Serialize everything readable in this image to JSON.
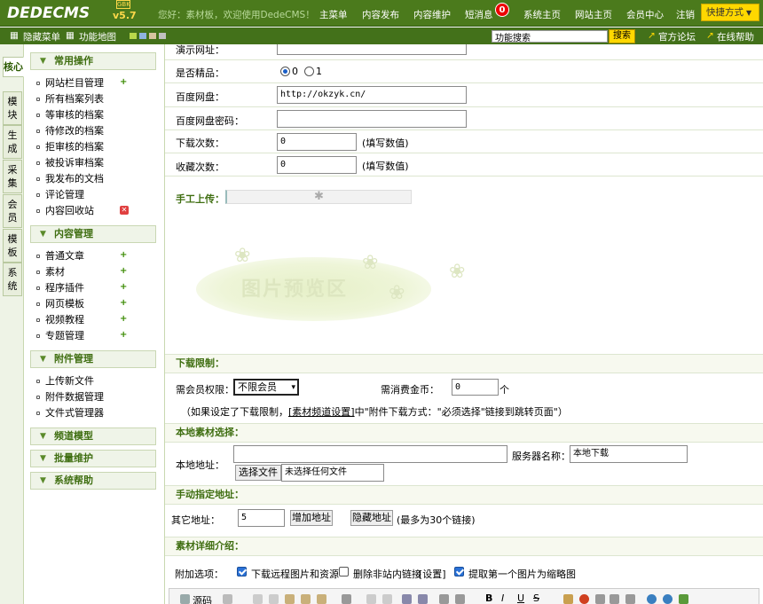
{
  "header": {
    "logo": "DEDECMS",
    "version": "v5.7",
    "badge": "GBK",
    "welcome": "您好：素材板，欢迎使用DedeCMS！",
    "nav": [
      "主菜单",
      "内容发布",
      "内容维护",
      "短消息",
      "系统主页",
      "网站主页",
      "会员中心",
      "注销"
    ],
    "message_count": "0",
    "quick_menu": "快捷方式"
  },
  "subbar": {
    "hide_menu": "隐藏菜单",
    "site_map": "功能地图",
    "search_value": "功能搜索",
    "search_button": "搜索",
    "official_forum": "官方论坛",
    "online_help": "在线帮助"
  },
  "sidebar": {
    "tabs": [
      "核心",
      "模块",
      "生成",
      "采集",
      "会员",
      "模板",
      "系统"
    ],
    "groups": [
      {
        "title": "常用操作",
        "items": [
          "网站栏目管理",
          "所有档案列表",
          "等审核的档案",
          "待修改的档案",
          "拒审核的档案",
          "被投诉审档案",
          "我发布的文档",
          "评论管理",
          "内容回收站"
        ]
      },
      {
        "title": "内容管理",
        "items": [
          "普通文章",
          "素材",
          "程序插件",
          "网页模板",
          "视频教程",
          "专题管理"
        ]
      },
      {
        "title": "附件管理",
        "items": [
          "上传新文件",
          "附件数据管理",
          "文件式管理器"
        ]
      },
      {
        "title": "频道模型",
        "items": []
      },
      {
        "title": "批量维护",
        "items": []
      },
      {
        "title": "系统帮助",
        "items": []
      }
    ]
  },
  "form": {
    "demo_url_label": "演示网址：",
    "is_best_label": "是否精品：",
    "is_best_options": [
      "0",
      "1"
    ],
    "baidu_pan_label": "百度网盘：",
    "baidu_pan_value": "http://okzyk.cn/",
    "baidu_pan_password_label": "百度网盘密码：",
    "download_count_label": "下载次数：",
    "download_count_value": "0",
    "download_count_hint": "(填写数值)",
    "favorite_count_label": "收藏次数：",
    "favorite_count_value": "0",
    "favorite_count_hint": "(填写数值)",
    "manual_upload_label": "手工上传：",
    "preview_text": "图片预览区"
  },
  "download_limit": {
    "title": "下载限制：",
    "member_perm_label": "需会员权限：",
    "member_perm_value": "不限会员",
    "gold_label": "需消费金币：",
    "gold_value": "0",
    "gold_unit": "个",
    "note_prefix": "（如果设定了下载限制，",
    "note_link": "[素材频道设置]",
    "note_suffix": "中\"附件下载方式：\"必须选择\"链接到跳转页面\"）"
  },
  "local_material": {
    "title": "本地素材选择：",
    "local_address_label": "本地地址：",
    "server_name_label": "服务器名称：",
    "server_name_value": "本地下载",
    "choose_file_button": "选择文件",
    "no_file_text": "未选择任何文件"
  },
  "manual_address": {
    "title": "手动指定地址：",
    "other_address_label": "其它地址：",
    "count_value": "5",
    "add_button": "增加地址",
    "hide_button": "隐藏地址",
    "hint": "(最多为30个链接)"
  },
  "material_detail": {
    "title": "素材详细介绍：",
    "options_label": "附加选项：",
    "options": [
      {
        "label": "下载远程图片和资源",
        "checked": true
      },
      {
        "label": "删除非站内链接",
        "checked": false
      },
      {
        "label": "[设置]",
        "checked": null
      },
      {
        "label": "提取第一个图片为缩略图",
        "checked": true
      }
    ],
    "toolbar_source": "源码"
  },
  "colors": {
    "header_green": "#4b7a1c",
    "section_green": "#3f6e11",
    "quick_yellow": "#ffd800"
  }
}
